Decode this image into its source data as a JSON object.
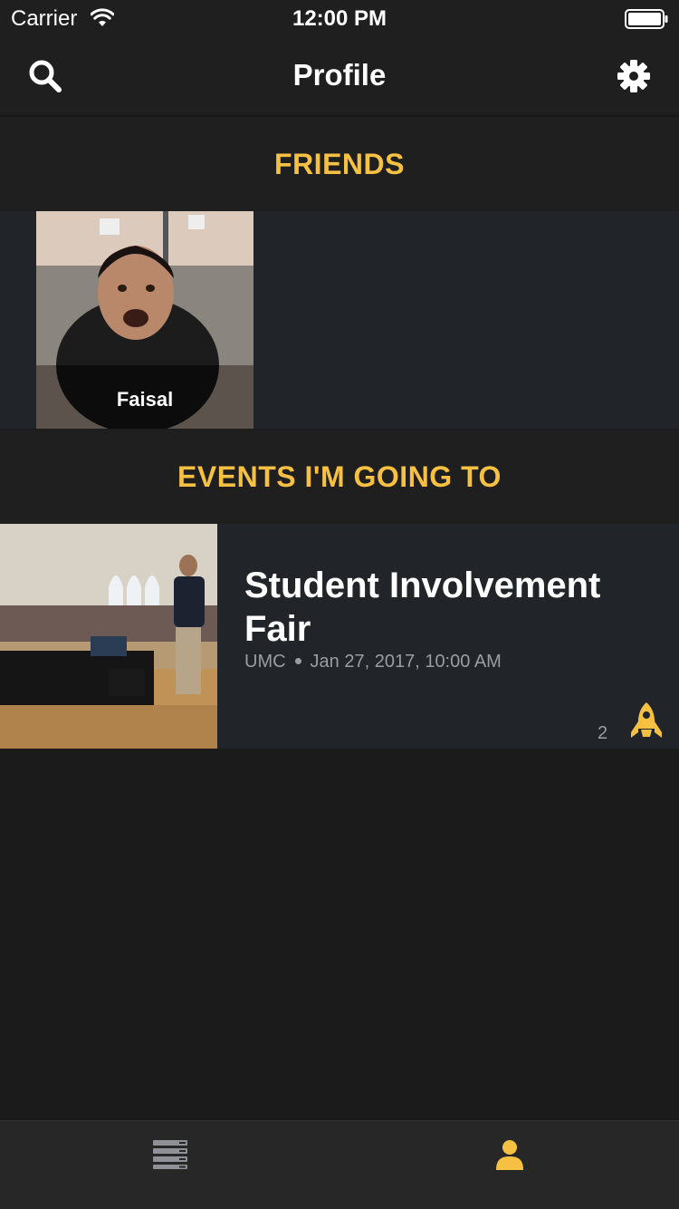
{
  "status_bar": {
    "carrier": "Carrier",
    "time": "12:00 PM",
    "icons": [
      "wifi-icon",
      "battery-icon"
    ]
  },
  "nav": {
    "title": "Profile",
    "left_icon": "search-icon",
    "right_icon": "gear-icon"
  },
  "friends": {
    "header": "FRIENDS",
    "items": [
      {
        "name": "Faisal"
      }
    ]
  },
  "events": {
    "header": "EVENTS I'M GOING TO",
    "items": [
      {
        "title": "Student Involvement Fair",
        "location": "UMC",
        "datetime": "Jan 27, 2017, 10:00 AM",
        "attendee_count": "2",
        "icon": "rocket-icon"
      }
    ]
  },
  "tab_bar": {
    "tabs": [
      {
        "icon": "feed-list-icon",
        "active": false
      },
      {
        "icon": "profile-person-icon",
        "active": true
      }
    ]
  },
  "colors": {
    "accent": "#f6c142",
    "background": "#1b1b1c",
    "card": "#21252a",
    "header": "#1f1f20",
    "muted_text": "#9a9da2"
  }
}
